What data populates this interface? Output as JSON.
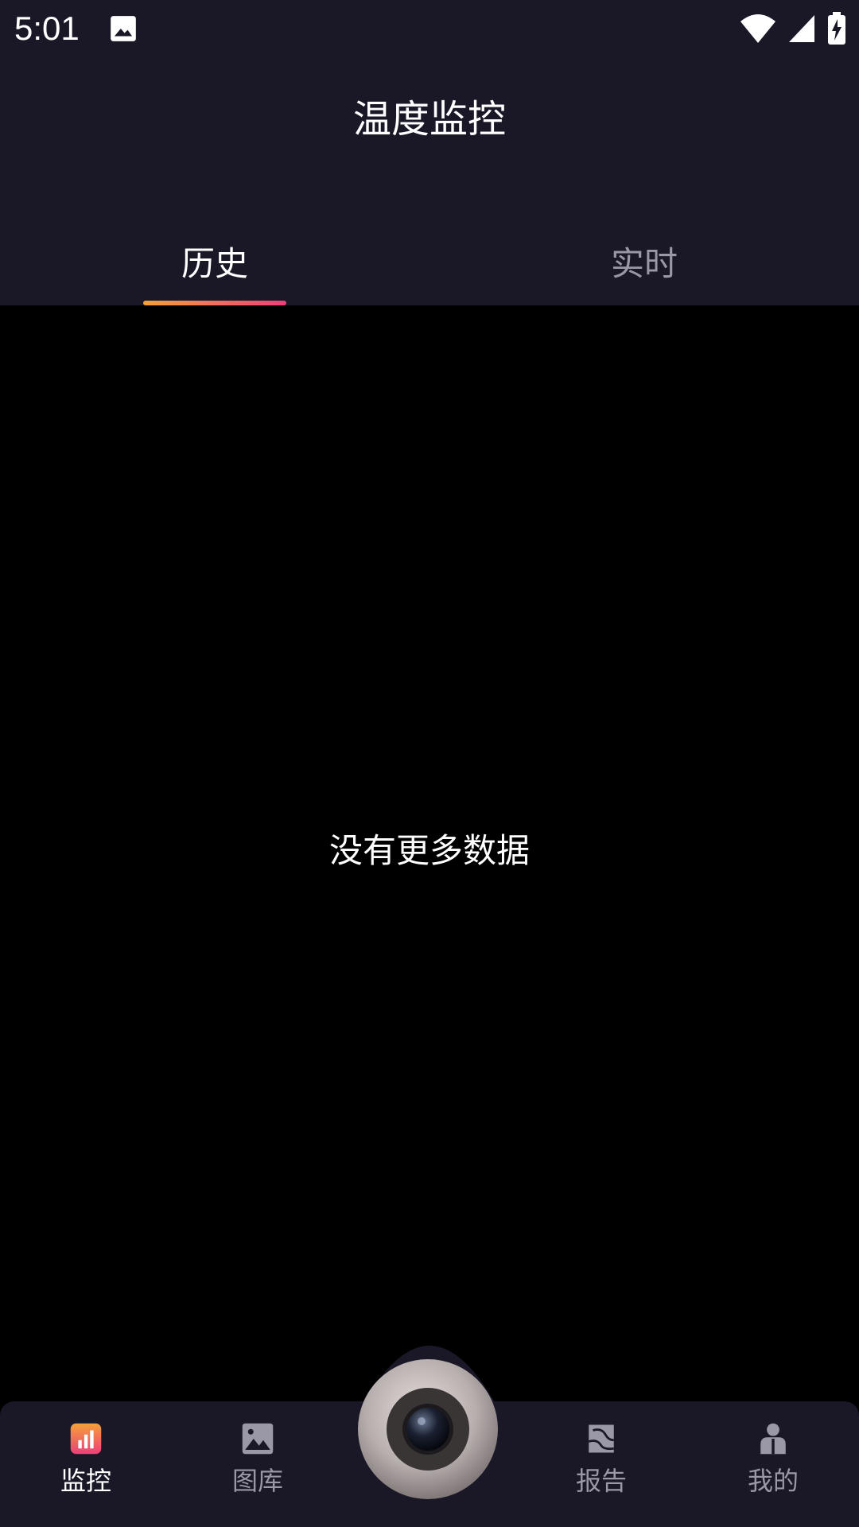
{
  "status_bar": {
    "time": "5:01",
    "icons": [
      "gallery-icon",
      "wifi-icon",
      "cell-signal-icon",
      "battery-charging-icon"
    ]
  },
  "header": {
    "title": "温度监控"
  },
  "tabs": [
    {
      "label": "历史",
      "active": true
    },
    {
      "label": "实时",
      "active": false
    }
  ],
  "main": {
    "empty_message": "没有更多数据"
  },
  "bottom_nav": {
    "items": [
      {
        "label": "监控",
        "icon": "monitor-chart-icon",
        "active": true
      },
      {
        "label": "图库",
        "icon": "gallery-icon",
        "active": false
      },
      {
        "label": "报告",
        "icon": "report-icon",
        "active": false
      },
      {
        "label": "我的",
        "icon": "profile-icon",
        "active": false
      }
    ],
    "center_button_icon": "camera-lens-icon"
  },
  "colors": {
    "bar_background": "#1a1727",
    "content_background": "#000000",
    "accent_start": "#f4a13a",
    "accent_end": "#ec3f79",
    "inactive_text": "#9a98a6"
  }
}
